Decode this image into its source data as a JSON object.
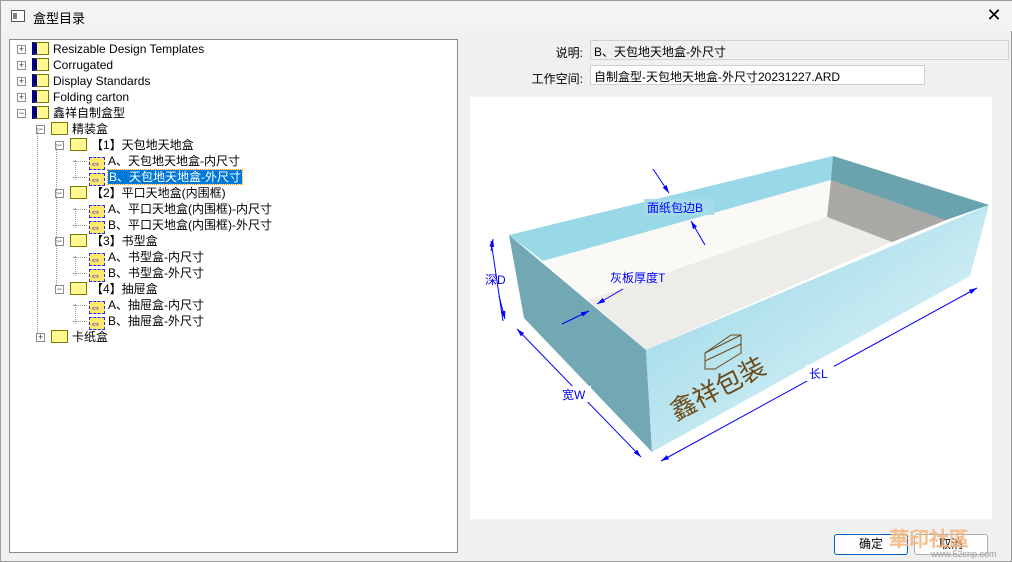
{
  "window": {
    "title": "盒型目录"
  },
  "tree": {
    "items": [
      {
        "label": "Resizable Design Templates",
        "level": 0,
        "type": "library",
        "expander": "+"
      },
      {
        "label": "Corrugated",
        "level": 0,
        "type": "library",
        "expander": "+"
      },
      {
        "label": "Display Standards",
        "level": 0,
        "type": "library",
        "expander": "+"
      },
      {
        "label": "Folding carton",
        "level": 0,
        "type": "library",
        "expander": "+"
      },
      {
        "label": "鑫祥自制盒型",
        "level": 0,
        "type": "library",
        "expander": "-"
      },
      {
        "label": "精装盒",
        "level": 1,
        "type": "folder",
        "expander": "-"
      },
      {
        "label": "【1】天包地天地盒",
        "level": 2,
        "type": "folder",
        "expander": "-"
      },
      {
        "label": "A、天包地天地盒-内尺寸",
        "level": 3,
        "type": "design"
      },
      {
        "label": "B、天包地天地盒-外尺寸",
        "level": 3,
        "type": "design",
        "selected": true
      },
      {
        "label": "【2】平口天地盒(内围框)",
        "level": 2,
        "type": "folder",
        "expander": "-"
      },
      {
        "label": "A、平口天地盒(内围框)-内尺寸",
        "level": 3,
        "type": "design"
      },
      {
        "label": "B、平口天地盒(内围框)-外尺寸",
        "level": 3,
        "type": "design"
      },
      {
        "label": "【3】书型盒",
        "level": 2,
        "type": "folder",
        "expander": "-"
      },
      {
        "label": "A、书型盒-内尺寸",
        "level": 3,
        "type": "design"
      },
      {
        "label": "B、书型盒-外尺寸",
        "level": 3,
        "type": "design"
      },
      {
        "label": "【4】抽屉盒",
        "level": 2,
        "type": "folder",
        "expander": "-"
      },
      {
        "label": "A、抽屉盒-内尺寸",
        "level": 3,
        "type": "design"
      },
      {
        "label": "B、抽屉盒-外尺寸",
        "level": 3,
        "type": "design"
      },
      {
        "label": "卡纸盒",
        "level": 1,
        "type": "folder",
        "expander": "+"
      }
    ]
  },
  "details": {
    "description_label": "说明:",
    "description_value": "B、天包地天地盒-外尺寸",
    "workspace_label": "工作空间:",
    "workspace_value": "自制盒型-天包地天地盒-外尺寸20231227.ARD"
  },
  "preview": {
    "labels": {
      "wrap": "面纸包边B",
      "depth": "深D",
      "board": "灰板厚度T",
      "width": "宽W",
      "length": "长L"
    },
    "logo_text": "鑫祥包装",
    "colors": {
      "box": "#8fd4e4",
      "dim": "#0000ff"
    }
  },
  "buttons": {
    "ok": "确定",
    "cancel": "取消"
  },
  "watermark": {
    "text": "華印社區",
    "url": "www.52cnp.com"
  }
}
